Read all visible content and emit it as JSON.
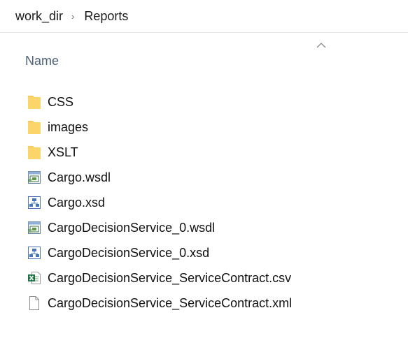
{
  "breadcrumb": {
    "items": [
      "work_dir",
      "Reports"
    ],
    "separator": "›"
  },
  "columns": {
    "name_label": "Name",
    "sort_icon": "chevron-up-icon"
  },
  "files": [
    {
      "name": "CSS",
      "icon": "folder-icon"
    },
    {
      "name": "images",
      "icon": "folder-icon"
    },
    {
      "name": "XSLT",
      "icon": "folder-icon"
    },
    {
      "name": "Cargo.wsdl",
      "icon": "wsdl-file-icon"
    },
    {
      "name": "Cargo.xsd",
      "icon": "xsd-file-icon"
    },
    {
      "name": "CargoDecisionService_0.wsdl",
      "icon": "wsdl-file-icon"
    },
    {
      "name": "CargoDecisionService_0.xsd",
      "icon": "xsd-file-icon"
    },
    {
      "name": "CargoDecisionService_ServiceContract.csv",
      "icon": "excel-csv-file-icon"
    },
    {
      "name": "CargoDecisionService_ServiceContract.xml",
      "icon": "blank-file-icon"
    }
  ],
  "colors": {
    "folder": "#f8c957",
    "header_text": "#4c607a",
    "divider": "#e6e6e6"
  }
}
